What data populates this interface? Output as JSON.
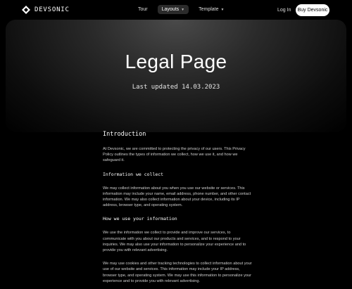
{
  "nav": {
    "brand": "DEVSONIC",
    "links": [
      {
        "label": "Tour"
      },
      {
        "label": "Layouts"
      },
      {
        "label": "Template"
      }
    ],
    "login": "Log In",
    "buy": "Buy Devsonic"
  },
  "hero": {
    "title": "Legal Page",
    "updated": "Last updated 14.03.2023"
  },
  "content": {
    "intro_heading": "Introduction",
    "intro_text": "At Devsonic, we are committed to protecting the privacy of our users. This Privacy Policy outlines the types of information we collect, how we use it, and how we safeguard it.",
    "collect_heading": "Information we collect",
    "collect_text": "We may collect information about you when you use our website or services. This information may include your name, email address, phone number, and other contact information. We may also collect information about your device, including its IP address, browser type, and operating system.",
    "use_heading": "How we use your information",
    "use_text_1": "We use the information we collect to provide and improve our services, to communicate with you about our products and services, and to respond to your inquiries. We may also use your information to personalize your experience and to provide you with relevant advertising.",
    "use_text_2": "We may use cookies and other tracking technologies to collect information about your use of our website and services. This information may include your IP address, browser type, and operating system. We may use this information to personalize your experience and to provide you with relevant advertising."
  }
}
